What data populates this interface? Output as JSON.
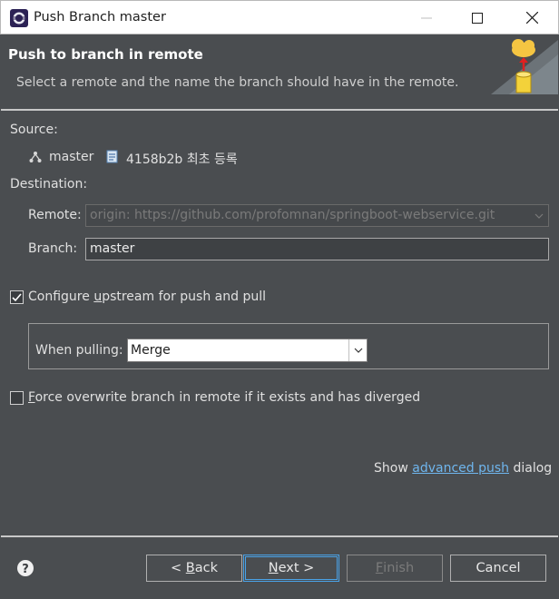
{
  "window": {
    "title": "Push Branch master",
    "minimize_glyph": "—",
    "maximize_glyph": "☐",
    "close_glyph": "✕"
  },
  "header": {
    "title": "Push to branch in remote",
    "description": "Select a remote and the name the branch should have in the remote."
  },
  "source": {
    "label": "Source:",
    "branch": "master",
    "commit": "4158b2b  최초 등록"
  },
  "destination": {
    "label": "Destination:",
    "remote_label": "Remote:",
    "remote_value": "origin: https://github.com/profomnan/springboot-webservice.git",
    "branch_label": "Branch:",
    "branch_value": "master"
  },
  "upstream": {
    "checked": true,
    "label_pre": "Configure ",
    "label_mnemonic": "u",
    "label_post": "pstream for push and pull",
    "pulling_label": "When pulling:",
    "pulling_value": "Merge"
  },
  "force": {
    "checked": false,
    "label_mnemonic": "F",
    "label_post": "orce overwrite branch in remote if it exists and has diverged"
  },
  "advanced": {
    "pre": "Show ",
    "link": "advanced push",
    "post": " dialog"
  },
  "buttons": {
    "back_pre": "< ",
    "back_mnemonic": "B",
    "back_post": "ack",
    "next_mnemonic": "N",
    "next_post": "ext >",
    "finish_mnemonic": "F",
    "finish_post": "inish",
    "cancel": "Cancel"
  },
  "colors": {
    "background": "#4a4d50",
    "link": "#6fb6ee",
    "default_button_border": "#4aa3e8"
  }
}
